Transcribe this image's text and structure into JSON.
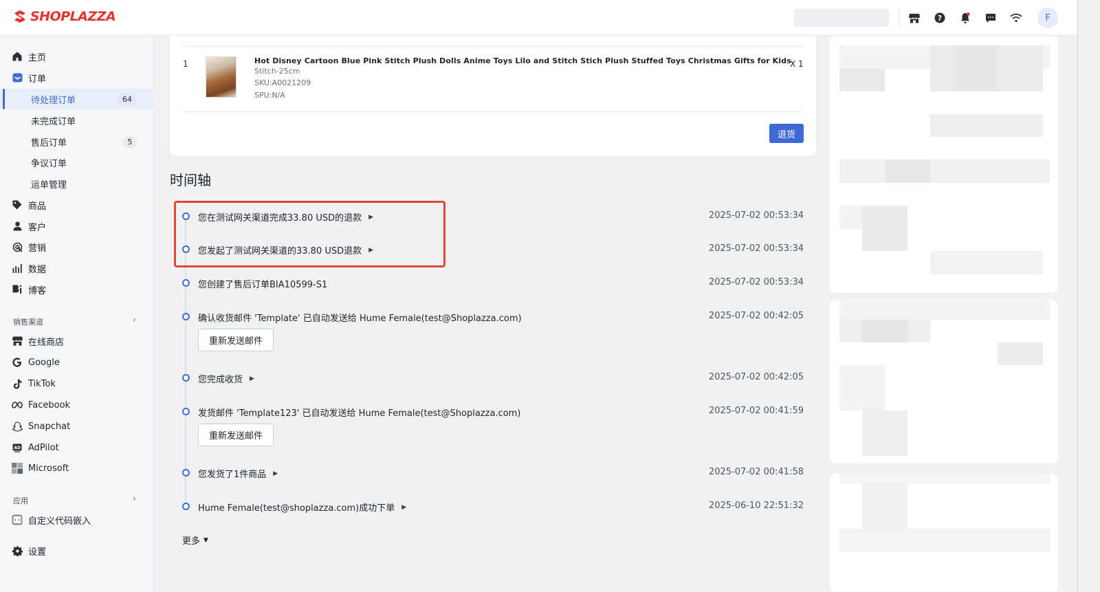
{
  "brand": {
    "logo_text": "SHOPLAZZA",
    "color": "#e5322d"
  },
  "topbar": {
    "icons": [
      "store-icon",
      "help-icon",
      "bell-icon",
      "message-icon",
      "wifi-icon"
    ],
    "avatar_initial": "F"
  },
  "sidebar": {
    "home": "主页",
    "orders": "订单",
    "pending_orders": "待处理订单",
    "pending_count": "64",
    "unfinished_orders": "未完成订单",
    "aftersale_orders": "售后订单",
    "aftersale_count": "5",
    "dispute_orders": "争议订单",
    "shipping": "运单管理",
    "products": "商品",
    "customers": "客户",
    "marketing": "营销",
    "data": "数据",
    "blog": "博客",
    "sales_channels": "销售渠道",
    "online_store": "在线商店",
    "google": "Google",
    "tiktok": "TikTok",
    "facebook": "Facebook",
    "snapchat": "Snapchat",
    "adpilot": "AdPilot",
    "microsoft": "Microsoft",
    "apps": "应用",
    "custom_code": "自定义代码嵌入",
    "settings": "设置"
  },
  "product": {
    "index": "1",
    "name": "Hot Disney Cartoon Blue Pink Stitch Plush Dolls Anime Toys Lilo and Stitch Stich Plush Stuffed Toys Christmas Gifts for Kids",
    "variant": "Stitch-25cm",
    "sku": "SKU:A0021209",
    "spu": "SPU:N/A",
    "qty": "X 1",
    "refund_button": "退货"
  },
  "timeline": {
    "title": "时间轴",
    "resend_label": "重新发送邮件",
    "more_label": "更多",
    "events": [
      {
        "text": "您在测试网关渠道完成33.80 USD的退款",
        "time": "2025-07-02 00:53:34"
      },
      {
        "text": "您发起了测试网关渠道的33.80 USD退款",
        "time": "2025-07-02 00:53:34"
      },
      {
        "text": "您创建了售后订单BIA10599-S1",
        "time": "2025-07-02 00:53:34"
      },
      {
        "text": "确认收货邮件 'Template' 已自动发送给 Hume Female(test@Shoplazza.com)",
        "time": "2025-07-02 00:42:05"
      },
      {
        "text": "您完成收货",
        "time": "2025-07-02 00:42:05"
      },
      {
        "text": "发货邮件 'Template123' 已自动发送给 Hume Female(test@Shoplazza.com)",
        "time": "2025-07-02 00:41:59"
      },
      {
        "text": "您发货了1件商品",
        "time": "2025-07-02 00:41:58"
      },
      {
        "text": "Hume Female(test@shoplazza.com)成功下单",
        "time": "2025-06-10 22:51:32"
      }
    ]
  },
  "colors": {
    "accent": "#3e6ad6",
    "highlight": "#e24638"
  }
}
